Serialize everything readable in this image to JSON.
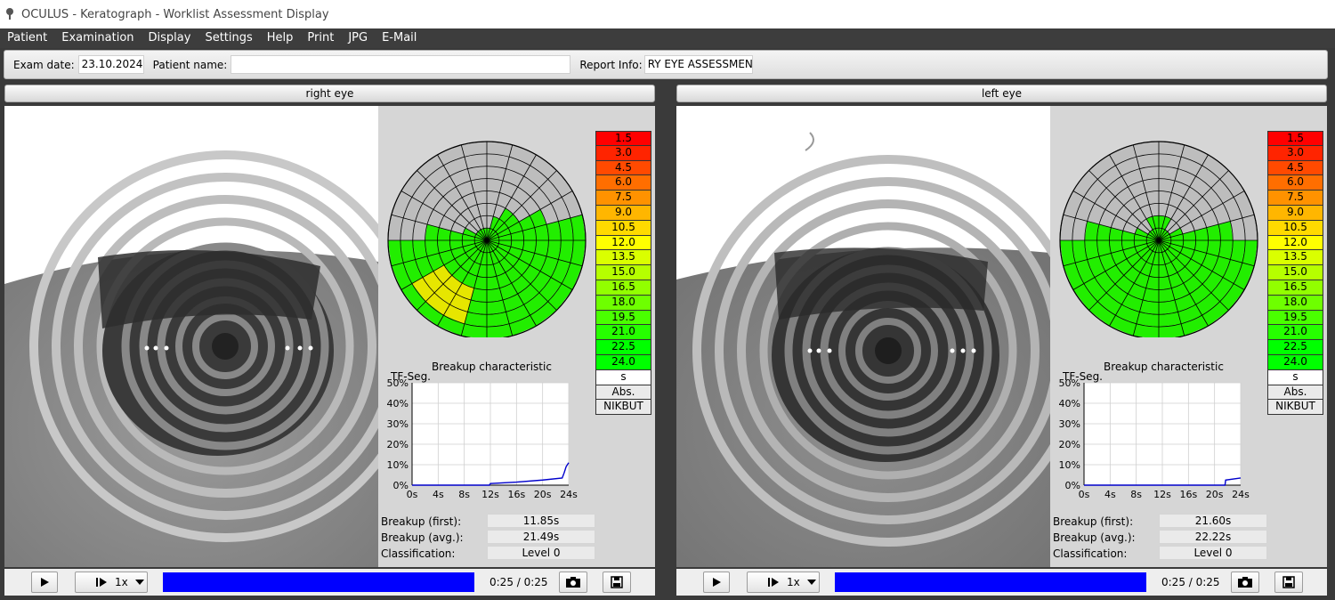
{
  "window": {
    "title": "OCULUS - Keratograph - Worklist Assessment Display"
  },
  "menu": [
    "Patient",
    "Examination",
    "Display",
    "Settings",
    "Help",
    "Print",
    "JPG",
    "E-Mail"
  ],
  "info": {
    "exam_date_label": "Exam date:",
    "exam_date": "23.10.2024",
    "patient_name_label": "Patient name:",
    "patient_name": "",
    "report_info_label": "Report Info:",
    "report_info": "RY EYE ASSESSMENT"
  },
  "legend": {
    "values": [
      "1.5",
      "3.0",
      "4.5",
      "6.0",
      "7.5",
      "9.0",
      "10.5",
      "12.0",
      "13.5",
      "15.0",
      "16.5",
      "18.0",
      "19.5",
      "21.0",
      "22.5",
      "24.0"
    ],
    "colors": [
      "#ff0000",
      "#ff2400",
      "#ff4a00",
      "#ff6e00",
      "#ff9200",
      "#ffb600",
      "#ffda00",
      "#ffff00",
      "#daff00",
      "#b6ff00",
      "#92ff00",
      "#6eff00",
      "#4aff00",
      "#26ff00",
      "#00ff00",
      "#00ff00"
    ],
    "unit": "s",
    "abs_label": "Abs.",
    "nikbut_label": "NIKBUT"
  },
  "chart_labels": {
    "title": "Breakup characteristic",
    "ylabel": "TF-Seg.",
    "yticks": [
      "0%",
      "10%",
      "20%",
      "30%",
      "40%",
      "50%"
    ],
    "xticks": [
      "0s",
      "4s",
      "8s",
      "12s",
      "16s",
      "20s",
      "24s"
    ]
  },
  "stat_labels": {
    "first": "Breakup (first):",
    "avg": "Breakup (avg.):",
    "classification": "Classification:"
  },
  "eyes": [
    {
      "header": "right eye",
      "breakup_first": "11.85s",
      "breakup_avg": "21.49s",
      "classification": "Level 0",
      "time": "0:25 / 0:25",
      "speed": "1x",
      "playback_progress": 1.0
    },
    {
      "header": "left eye",
      "breakup_first": "21.60s",
      "breakup_avg": "22.22s",
      "classification": "Level 0",
      "time": "0:25 / 0:25",
      "speed": "1x",
      "playback_progress": 1.0
    }
  ],
  "chart_data": [
    {
      "type": "line",
      "title": "Breakup characteristic",
      "ylabel": "TF-Seg.",
      "xlim": [
        0,
        24
      ],
      "ylim": [
        0,
        50
      ],
      "grid": true,
      "series": [
        {
          "x": [
            0,
            11.85,
            12,
            16,
            20,
            23,
            23.3,
            23.6,
            24
          ],
          "y": [
            0,
            0,
            0.8,
            1.5,
            2.5,
            3.5,
            6,
            9,
            11
          ]
        }
      ]
    },
    {
      "type": "line",
      "title": "Breakup characteristic",
      "ylabel": "TF-Seg.",
      "xlim": [
        0,
        24
      ],
      "ylim": [
        0,
        50
      ],
      "grid": true,
      "series": [
        {
          "x": [
            0,
            21.6,
            21.7,
            24
          ],
          "y": [
            0,
            0,
            2.5,
            3.5
          ]
        }
      ]
    }
  ]
}
